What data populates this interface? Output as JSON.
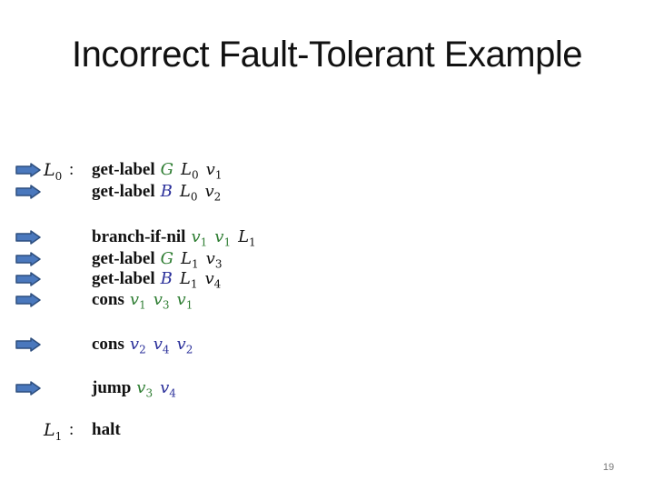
{
  "slide": {
    "title": "Incorrect Fault-Tolerant Example",
    "page_number": "19"
  },
  "colors": {
    "green": "#2e7d32",
    "blue": "#2a2f9a",
    "arrow_fill": "#4a78bd",
    "arrow_stroke": "#2d4e7e"
  },
  "program": [
    {
      "label": "L",
      "label_sub": "0",
      "arrow": true,
      "op": "get-label",
      "args": [
        {
          "t": "G",
          "s": "",
          "c": "green"
        },
        {
          "t": "L",
          "s": "0",
          "c": "black"
        },
        {
          "t": "v",
          "s": "1",
          "c": "black"
        }
      ]
    },
    {
      "label": "",
      "label_sub": "",
      "arrow": true,
      "op": "get-label",
      "args": [
        {
          "t": "B",
          "s": "",
          "c": "blue"
        },
        {
          "t": "L",
          "s": "0",
          "c": "black"
        },
        {
          "t": "v",
          "s": "2",
          "c": "black"
        }
      ]
    },
    {
      "label": "",
      "label_sub": "",
      "arrow": true,
      "op": "branch-if-nil",
      "args": [
        {
          "t": "v",
          "s": "1",
          "c": "green"
        },
        {
          "t": "v",
          "s": "1",
          "c": "green"
        },
        {
          "t": "L",
          "s": "1",
          "c": "black"
        }
      ]
    },
    {
      "label": "",
      "label_sub": "",
      "arrow": true,
      "op": "get-label",
      "args": [
        {
          "t": "G",
          "s": "",
          "c": "green"
        },
        {
          "t": "L",
          "s": "1",
          "c": "black"
        },
        {
          "t": "v",
          "s": "3",
          "c": "black"
        }
      ]
    },
    {
      "label": "",
      "label_sub": "",
      "arrow": true,
      "op": "get-label",
      "args": [
        {
          "t": "B",
          "s": "",
          "c": "blue"
        },
        {
          "t": "L",
          "s": "1",
          "c": "black"
        },
        {
          "t": "v",
          "s": "4",
          "c": "black"
        }
      ]
    },
    {
      "label": "",
      "label_sub": "",
      "arrow": true,
      "op": "cons",
      "args": [
        {
          "t": "v",
          "s": "1",
          "c": "green"
        },
        {
          "t": "v",
          "s": "3",
          "c": "green"
        },
        {
          "t": "v",
          "s": "1",
          "c": "green"
        }
      ]
    },
    {
      "label": "",
      "label_sub": "",
      "arrow": true,
      "op": "cons",
      "args": [
        {
          "t": "v",
          "s": "2",
          "c": "blue"
        },
        {
          "t": "v",
          "s": "4",
          "c": "blue"
        },
        {
          "t": "v",
          "s": "2",
          "c": "blue"
        }
      ]
    },
    {
      "label": "",
      "label_sub": "",
      "arrow": true,
      "op": "jump",
      "args": [
        {
          "t": "v",
          "s": "3",
          "c": "green"
        },
        {
          "t": "v",
          "s": "4",
          "c": "blue"
        }
      ]
    },
    {
      "label": "L",
      "label_sub": "1",
      "arrow": false,
      "op": "halt",
      "args": []
    }
  ]
}
